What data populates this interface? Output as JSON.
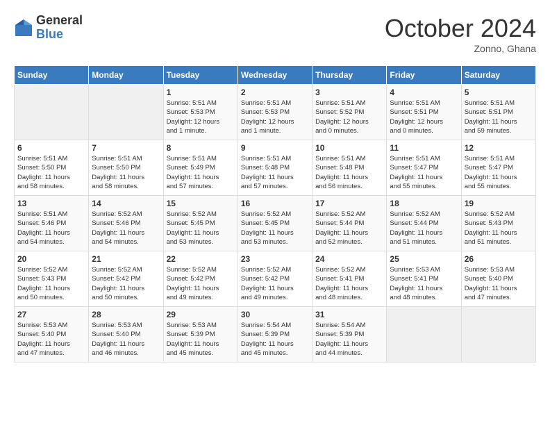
{
  "logo": {
    "general": "General",
    "blue": "Blue"
  },
  "title": "October 2024",
  "location": "Zonno, Ghana",
  "days_header": [
    "Sunday",
    "Monday",
    "Tuesday",
    "Wednesday",
    "Thursday",
    "Friday",
    "Saturday"
  ],
  "weeks": [
    [
      {
        "day": "",
        "info": ""
      },
      {
        "day": "",
        "info": ""
      },
      {
        "day": "1",
        "info": "Sunrise: 5:51 AM\nSunset: 5:53 PM\nDaylight: 12 hours\nand 1 minute."
      },
      {
        "day": "2",
        "info": "Sunrise: 5:51 AM\nSunset: 5:53 PM\nDaylight: 12 hours\nand 1 minute."
      },
      {
        "day": "3",
        "info": "Sunrise: 5:51 AM\nSunset: 5:52 PM\nDaylight: 12 hours\nand 0 minutes."
      },
      {
        "day": "4",
        "info": "Sunrise: 5:51 AM\nSunset: 5:51 PM\nDaylight: 12 hours\nand 0 minutes."
      },
      {
        "day": "5",
        "info": "Sunrise: 5:51 AM\nSunset: 5:51 PM\nDaylight: 11 hours\nand 59 minutes."
      }
    ],
    [
      {
        "day": "6",
        "info": "Sunrise: 5:51 AM\nSunset: 5:50 PM\nDaylight: 11 hours\nand 58 minutes."
      },
      {
        "day": "7",
        "info": "Sunrise: 5:51 AM\nSunset: 5:50 PM\nDaylight: 11 hours\nand 58 minutes."
      },
      {
        "day": "8",
        "info": "Sunrise: 5:51 AM\nSunset: 5:49 PM\nDaylight: 11 hours\nand 57 minutes."
      },
      {
        "day": "9",
        "info": "Sunrise: 5:51 AM\nSunset: 5:48 PM\nDaylight: 11 hours\nand 57 minutes."
      },
      {
        "day": "10",
        "info": "Sunrise: 5:51 AM\nSunset: 5:48 PM\nDaylight: 11 hours\nand 56 minutes."
      },
      {
        "day": "11",
        "info": "Sunrise: 5:51 AM\nSunset: 5:47 PM\nDaylight: 11 hours\nand 55 minutes."
      },
      {
        "day": "12",
        "info": "Sunrise: 5:51 AM\nSunset: 5:47 PM\nDaylight: 11 hours\nand 55 minutes."
      }
    ],
    [
      {
        "day": "13",
        "info": "Sunrise: 5:51 AM\nSunset: 5:46 PM\nDaylight: 11 hours\nand 54 minutes."
      },
      {
        "day": "14",
        "info": "Sunrise: 5:52 AM\nSunset: 5:46 PM\nDaylight: 11 hours\nand 54 minutes."
      },
      {
        "day": "15",
        "info": "Sunrise: 5:52 AM\nSunset: 5:45 PM\nDaylight: 11 hours\nand 53 minutes."
      },
      {
        "day": "16",
        "info": "Sunrise: 5:52 AM\nSunset: 5:45 PM\nDaylight: 11 hours\nand 53 minutes."
      },
      {
        "day": "17",
        "info": "Sunrise: 5:52 AM\nSunset: 5:44 PM\nDaylight: 11 hours\nand 52 minutes."
      },
      {
        "day": "18",
        "info": "Sunrise: 5:52 AM\nSunset: 5:44 PM\nDaylight: 11 hours\nand 51 minutes."
      },
      {
        "day": "19",
        "info": "Sunrise: 5:52 AM\nSunset: 5:43 PM\nDaylight: 11 hours\nand 51 minutes."
      }
    ],
    [
      {
        "day": "20",
        "info": "Sunrise: 5:52 AM\nSunset: 5:43 PM\nDaylight: 11 hours\nand 50 minutes."
      },
      {
        "day": "21",
        "info": "Sunrise: 5:52 AM\nSunset: 5:42 PM\nDaylight: 11 hours\nand 50 minutes."
      },
      {
        "day": "22",
        "info": "Sunrise: 5:52 AM\nSunset: 5:42 PM\nDaylight: 11 hours\nand 49 minutes."
      },
      {
        "day": "23",
        "info": "Sunrise: 5:52 AM\nSunset: 5:42 PM\nDaylight: 11 hours\nand 49 minutes."
      },
      {
        "day": "24",
        "info": "Sunrise: 5:52 AM\nSunset: 5:41 PM\nDaylight: 11 hours\nand 48 minutes."
      },
      {
        "day": "25",
        "info": "Sunrise: 5:53 AM\nSunset: 5:41 PM\nDaylight: 11 hours\nand 48 minutes."
      },
      {
        "day": "26",
        "info": "Sunrise: 5:53 AM\nSunset: 5:40 PM\nDaylight: 11 hours\nand 47 minutes."
      }
    ],
    [
      {
        "day": "27",
        "info": "Sunrise: 5:53 AM\nSunset: 5:40 PM\nDaylight: 11 hours\nand 47 minutes."
      },
      {
        "day": "28",
        "info": "Sunrise: 5:53 AM\nSunset: 5:40 PM\nDaylight: 11 hours\nand 46 minutes."
      },
      {
        "day": "29",
        "info": "Sunrise: 5:53 AM\nSunset: 5:39 PM\nDaylight: 11 hours\nand 45 minutes."
      },
      {
        "day": "30",
        "info": "Sunrise: 5:54 AM\nSunset: 5:39 PM\nDaylight: 11 hours\nand 45 minutes."
      },
      {
        "day": "31",
        "info": "Sunrise: 5:54 AM\nSunset: 5:39 PM\nDaylight: 11 hours\nand 44 minutes."
      },
      {
        "day": "",
        "info": ""
      },
      {
        "day": "",
        "info": ""
      }
    ]
  ]
}
